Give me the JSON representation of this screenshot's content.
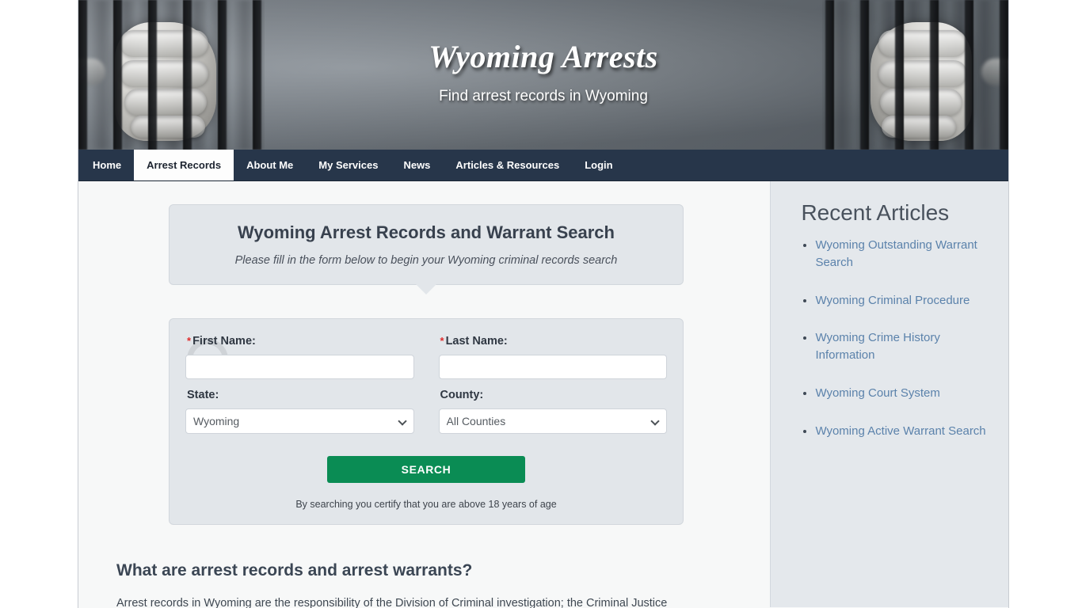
{
  "banner": {
    "title": "Wyoming Arrests",
    "subtitle": "Find arrest records in Wyoming",
    "image_left": "jail-bars-hand-photo",
    "image_right": "jail-bars-hand-photo"
  },
  "nav": {
    "items": [
      {
        "label": "Home",
        "active": false
      },
      {
        "label": "Arrest Records",
        "active": true
      },
      {
        "label": "About Me",
        "active": false
      },
      {
        "label": "My Services",
        "active": false
      },
      {
        "label": "News",
        "active": false
      },
      {
        "label": "Articles & Resources",
        "active": false
      },
      {
        "label": "Login",
        "active": false
      }
    ]
  },
  "form_header": {
    "title": "Wyoming Arrest Records and Warrant Search",
    "subtitle": "Please fill in the form below to begin your Wyoming criminal records search"
  },
  "search_form": {
    "required_marker": "*",
    "first_name": {
      "label": "First Name:",
      "value": "",
      "placeholder": ""
    },
    "last_name": {
      "label": "Last Name:",
      "value": "",
      "placeholder": ""
    },
    "state": {
      "label": "State:",
      "value": "Wyoming",
      "options": [
        "Wyoming"
      ]
    },
    "county": {
      "label": "County:",
      "value": "All Counties",
      "options": [
        "All Counties"
      ]
    },
    "submit_label": "SEARCH",
    "disclaimer": "By searching you certify that you are above 18 years of age",
    "loading_indicator": "spinner-icon"
  },
  "article": {
    "heading": "What are arrest records and arrest warrants?",
    "paragraph": "Arrest records in Wyoming are the responsibility of the Division of Criminal investigation; the Criminal Justice"
  },
  "sidebar": {
    "title": "Recent Articles",
    "articles": [
      {
        "label": "Wyoming Outstanding Warrant Search"
      },
      {
        "label": "Wyoming Criminal Procedure"
      },
      {
        "label": "Wyoming Crime History Information"
      },
      {
        "label": "Wyoming Court System"
      },
      {
        "label": "Wyoming Active Warrant Search"
      }
    ]
  },
  "colors": {
    "nav_background": "#27364a",
    "nav_active_background": "#fdfdfd",
    "panel_background": "#e2e6ea",
    "sidebar_background": "#e4e8ec",
    "link": "#5b82ab",
    "search_button": "#0a8c54",
    "required_asterisk": "#e02b2b",
    "page_background": "#f7f8f8"
  }
}
